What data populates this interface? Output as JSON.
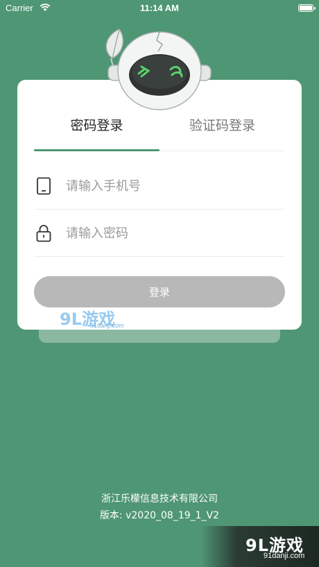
{
  "status_bar": {
    "carrier": "Carrier",
    "time": "11:14 AM"
  },
  "login": {
    "tabs": [
      {
        "label": "密码登录",
        "active": true
      },
      {
        "label": "验证码登录",
        "active": false
      }
    ],
    "phone": {
      "placeholder": "请输入手机号",
      "value": "",
      "icon": "phone-icon"
    },
    "password": {
      "placeholder": "请输入密码",
      "value": "",
      "icon": "lock-icon"
    },
    "submit_label": "登录"
  },
  "footer": {
    "company": "浙江乐檬信息技术有限公司",
    "version": "版本: v2020_08_19_1_V2"
  },
  "watermark": {
    "logo": "9L游戏",
    "site": "91danji.com"
  },
  "colors": {
    "background": "#4f9674",
    "accent": "#4f9674",
    "button_disabled": "#b8b8b8"
  }
}
